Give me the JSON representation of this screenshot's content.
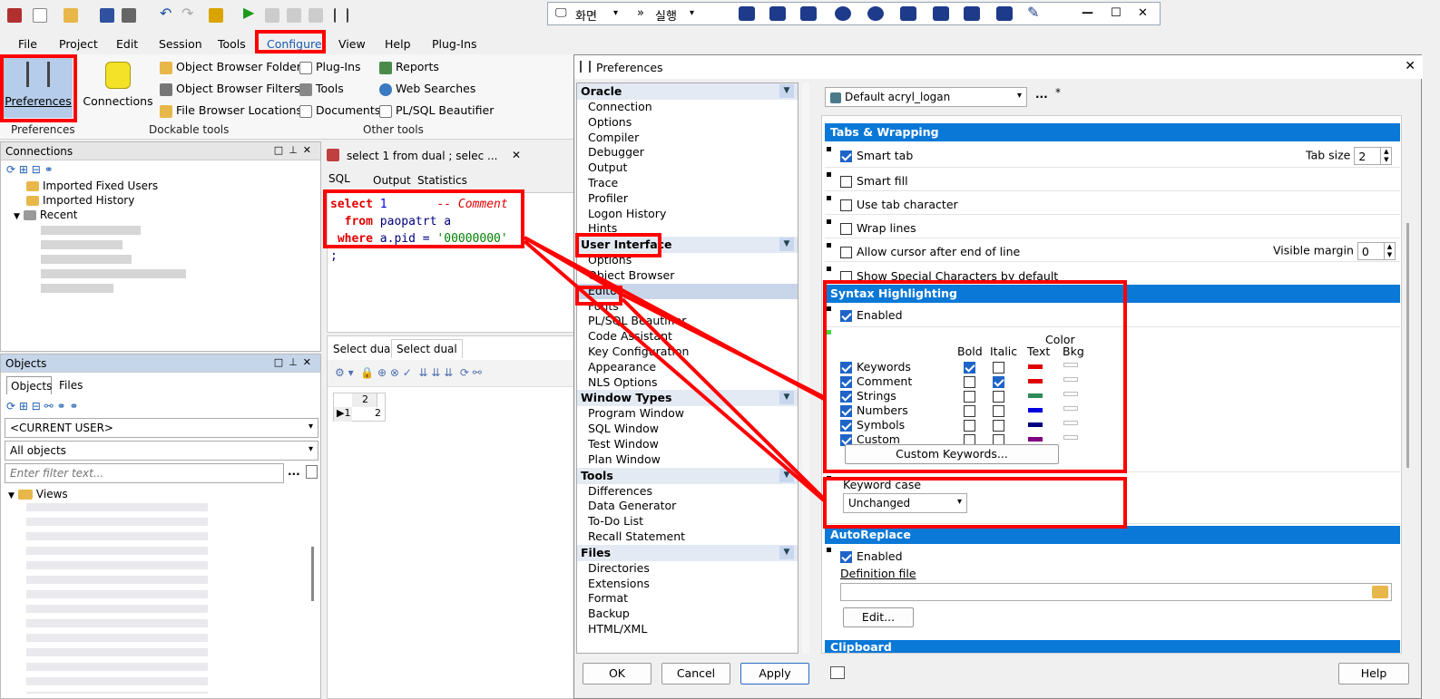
{
  "remote_bar": {
    "screen_label": "화면",
    "run_label": "실행"
  },
  "menu": [
    "File",
    "Project",
    "Edit",
    "Session",
    "Tools",
    "Configure",
    "View",
    "Help",
    "Plug-Ins"
  ],
  "ribbon": {
    "preferences": "Preferences",
    "connections": "Connections",
    "obj_browser_folders": "Object Browser Folders",
    "obj_browser_filters": "Object Browser Filters",
    "file_browser_locations": "File Browser Locations",
    "plugins": "Plug-Ins",
    "tools": "Tools",
    "documents": "Documents",
    "reports": "Reports",
    "web_searches": "Web Searches",
    "plsql_beautifier": "PL/SQL Beautifier",
    "group_preferences": "Preferences",
    "group_dockable": "Dockable tools",
    "group_other": "Other tools"
  },
  "connections_panel": {
    "title": "Connections",
    "items": [
      "Imported Fixed Users",
      "Imported History",
      "Recent"
    ]
  },
  "objects_panel": {
    "title": "Objects",
    "tab_objects": "Objects",
    "tab_files": "Files",
    "user_combo": "<CURRENT USER>",
    "objects_combo": "All objects",
    "filter_placeholder": "Enter filter text...",
    "tree_root": "Views"
  },
  "sql_window": {
    "tab_title": "select 1 from dual ; selec ...",
    "sub_tabs": [
      "SQL",
      "Output",
      "Statistics"
    ],
    "code_line1_kw": "select",
    "code_line1_num": "1",
    "code_line1_comment": "-- Comment",
    "code_line2_kw": "from",
    "code_line2_id": "paopatrt a",
    "code_line3_kw": "where",
    "code_line3_id": "a.pid =",
    "code_line3_str": "'00000000'",
    "code_line4": ";",
    "result_tabs": [
      "Select dual",
      "Select dual"
    ],
    "grid_header": "2",
    "grid_row_num": "1",
    "grid_value": "2"
  },
  "preferences": {
    "title": "Preferences",
    "profile": "Default acryl_logan",
    "more": "...",
    "modified": "*",
    "categories": [
      {
        "header": "Oracle",
        "items": [
          "Connection",
          "Options",
          "Compiler",
          "Debugger",
          "Output",
          "Trace",
          "Profiler",
          "Logon History",
          "Hints"
        ]
      },
      {
        "header": "User Interface",
        "items": [
          "Options",
          "Object Browser",
          "Editor",
          "Fonts",
          "PL/SQL Beautifier",
          "Code Assistant",
          "Key Configuration",
          "Appearance",
          "NLS Options"
        ]
      },
      {
        "header": "Window Types",
        "items": [
          "Program Window",
          "SQL Window",
          "Test Window",
          "Plan Window"
        ]
      },
      {
        "header": "Tools",
        "items": [
          "Differences",
          "Data Generator",
          "To-Do List",
          "Recall Statement"
        ]
      },
      {
        "header": "Files",
        "items": [
          "Directories",
          "Extensions",
          "Format",
          "Backup",
          "HTML/XML"
        ]
      }
    ],
    "tabs_wrapping": {
      "header": "Tabs & Wrapping",
      "smart_tab": "Smart tab",
      "tab_size_label": "Tab size",
      "tab_size": "2",
      "smart_fill": "Smart fill",
      "use_tab_char": "Use tab character",
      "wrap_lines": "Wrap lines",
      "allow_cursor": "Allow cursor after end of line",
      "visible_margin_label": "Visible margin",
      "visible_margin": "0",
      "show_special": "Show Special Characters by default"
    },
    "syntax": {
      "header": "Syntax Highlighting",
      "enabled": "Enabled",
      "col_color": "Color",
      "col_bold": "Bold",
      "col_italic": "Italic",
      "col_text": "Text",
      "col_bkg": "Bkg",
      "rows": [
        {
          "name": "Keywords",
          "bold": true,
          "italic": false,
          "color": "#e00000"
        },
        {
          "name": "Comment",
          "bold": false,
          "italic": true,
          "color": "#e00000"
        },
        {
          "name": "Strings",
          "bold": false,
          "italic": false,
          "color": "#2e8b57"
        },
        {
          "name": "Numbers",
          "bold": false,
          "italic": false,
          "color": "#0000e0"
        },
        {
          "name": "Symbols",
          "bold": false,
          "italic": false,
          "color": "#000080"
        },
        {
          "name": "Custom",
          "bold": false,
          "italic": false,
          "color": "#800080"
        }
      ],
      "custom_keywords": "Custom Keywords..."
    },
    "keyword_case": {
      "label": "Keyword case",
      "value": "Unchanged"
    },
    "autoreplace": {
      "header": "AutoReplace",
      "enabled": "Enabled",
      "definition_file": "Definition file",
      "edit": "Edit..."
    },
    "clipboard_header": "Clipboard",
    "buttons": {
      "ok": "OK",
      "cancel": "Cancel",
      "apply": "Apply",
      "help": "Help"
    }
  }
}
